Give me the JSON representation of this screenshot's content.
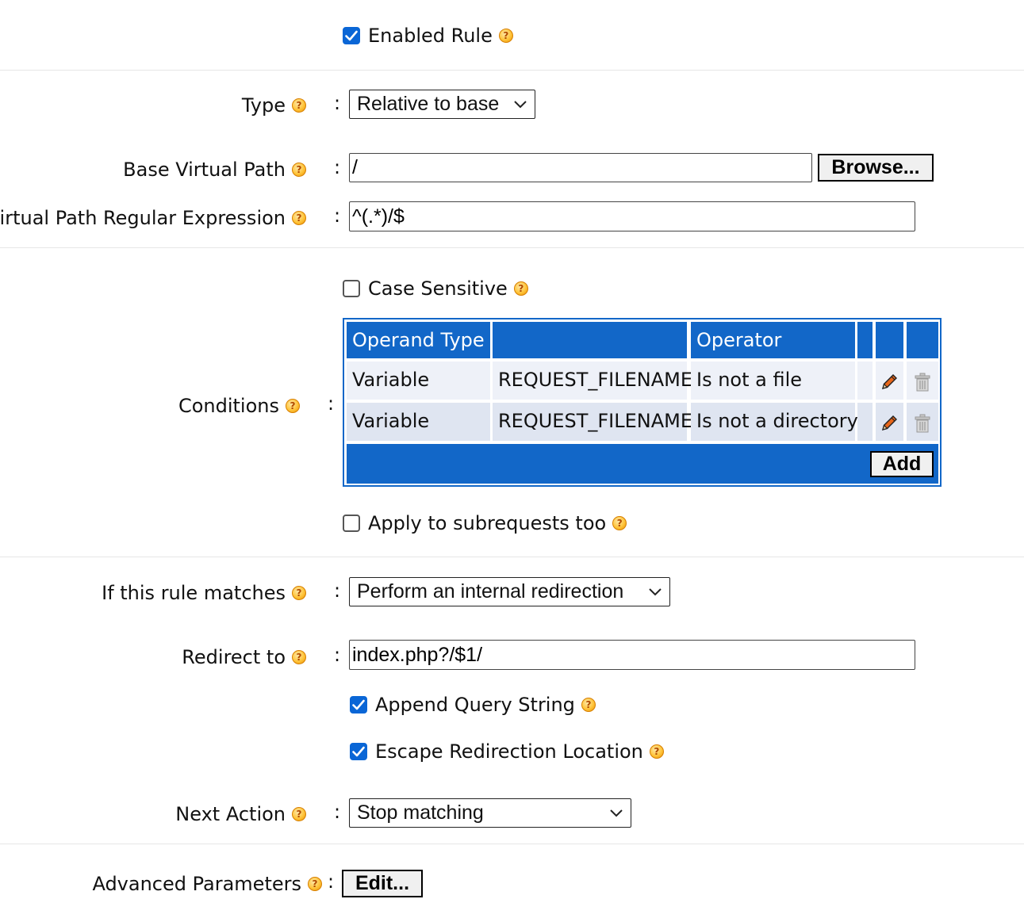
{
  "enabled_rule": {
    "label": "Enabled Rule",
    "checked": true
  },
  "type": {
    "label": "Type",
    "value": "Relative to base"
  },
  "base_virtual_path": {
    "label": "Base Virtual Path",
    "value": "/",
    "browse_label": "Browse..."
  },
  "regex": {
    "label": "Virtual Path Regular Expression",
    "value": "^(.*)/$"
  },
  "case_sensitive": {
    "label": "Case Sensitive",
    "checked": false
  },
  "conditions": {
    "label": "Conditions",
    "headers": [
      "Operand Type",
      "",
      "Operator",
      "",
      "",
      ""
    ],
    "rows": [
      {
        "operand_type": "Variable",
        "operand": "REQUEST_FILENAME",
        "operator": "Is not a file"
      },
      {
        "operand_type": "Variable",
        "operand": "REQUEST_FILENAME",
        "operator": "Is not a directory"
      }
    ],
    "add_label": "Add"
  },
  "apply_subrequests": {
    "label": "Apply to subrequests too",
    "checked": false
  },
  "if_matches": {
    "label": "If this rule matches",
    "value": "Perform an internal redirection"
  },
  "redirect_to": {
    "label": "Redirect to",
    "value": "index.php?/$1/"
  },
  "append_query": {
    "label": "Append Query String",
    "checked": true
  },
  "escape_redirect": {
    "label": "Escape Redirection Location",
    "checked": true
  },
  "next_action": {
    "label": "Next Action",
    "value": "Stop matching"
  },
  "advanced": {
    "label": "Advanced Parameters",
    "edit_label": "Edit..."
  },
  "colon": ":",
  "help_glyph": "?",
  "colors": {
    "accent": "#1267c8",
    "checkbox": "#0a66d6",
    "help": "#ffc43a"
  }
}
